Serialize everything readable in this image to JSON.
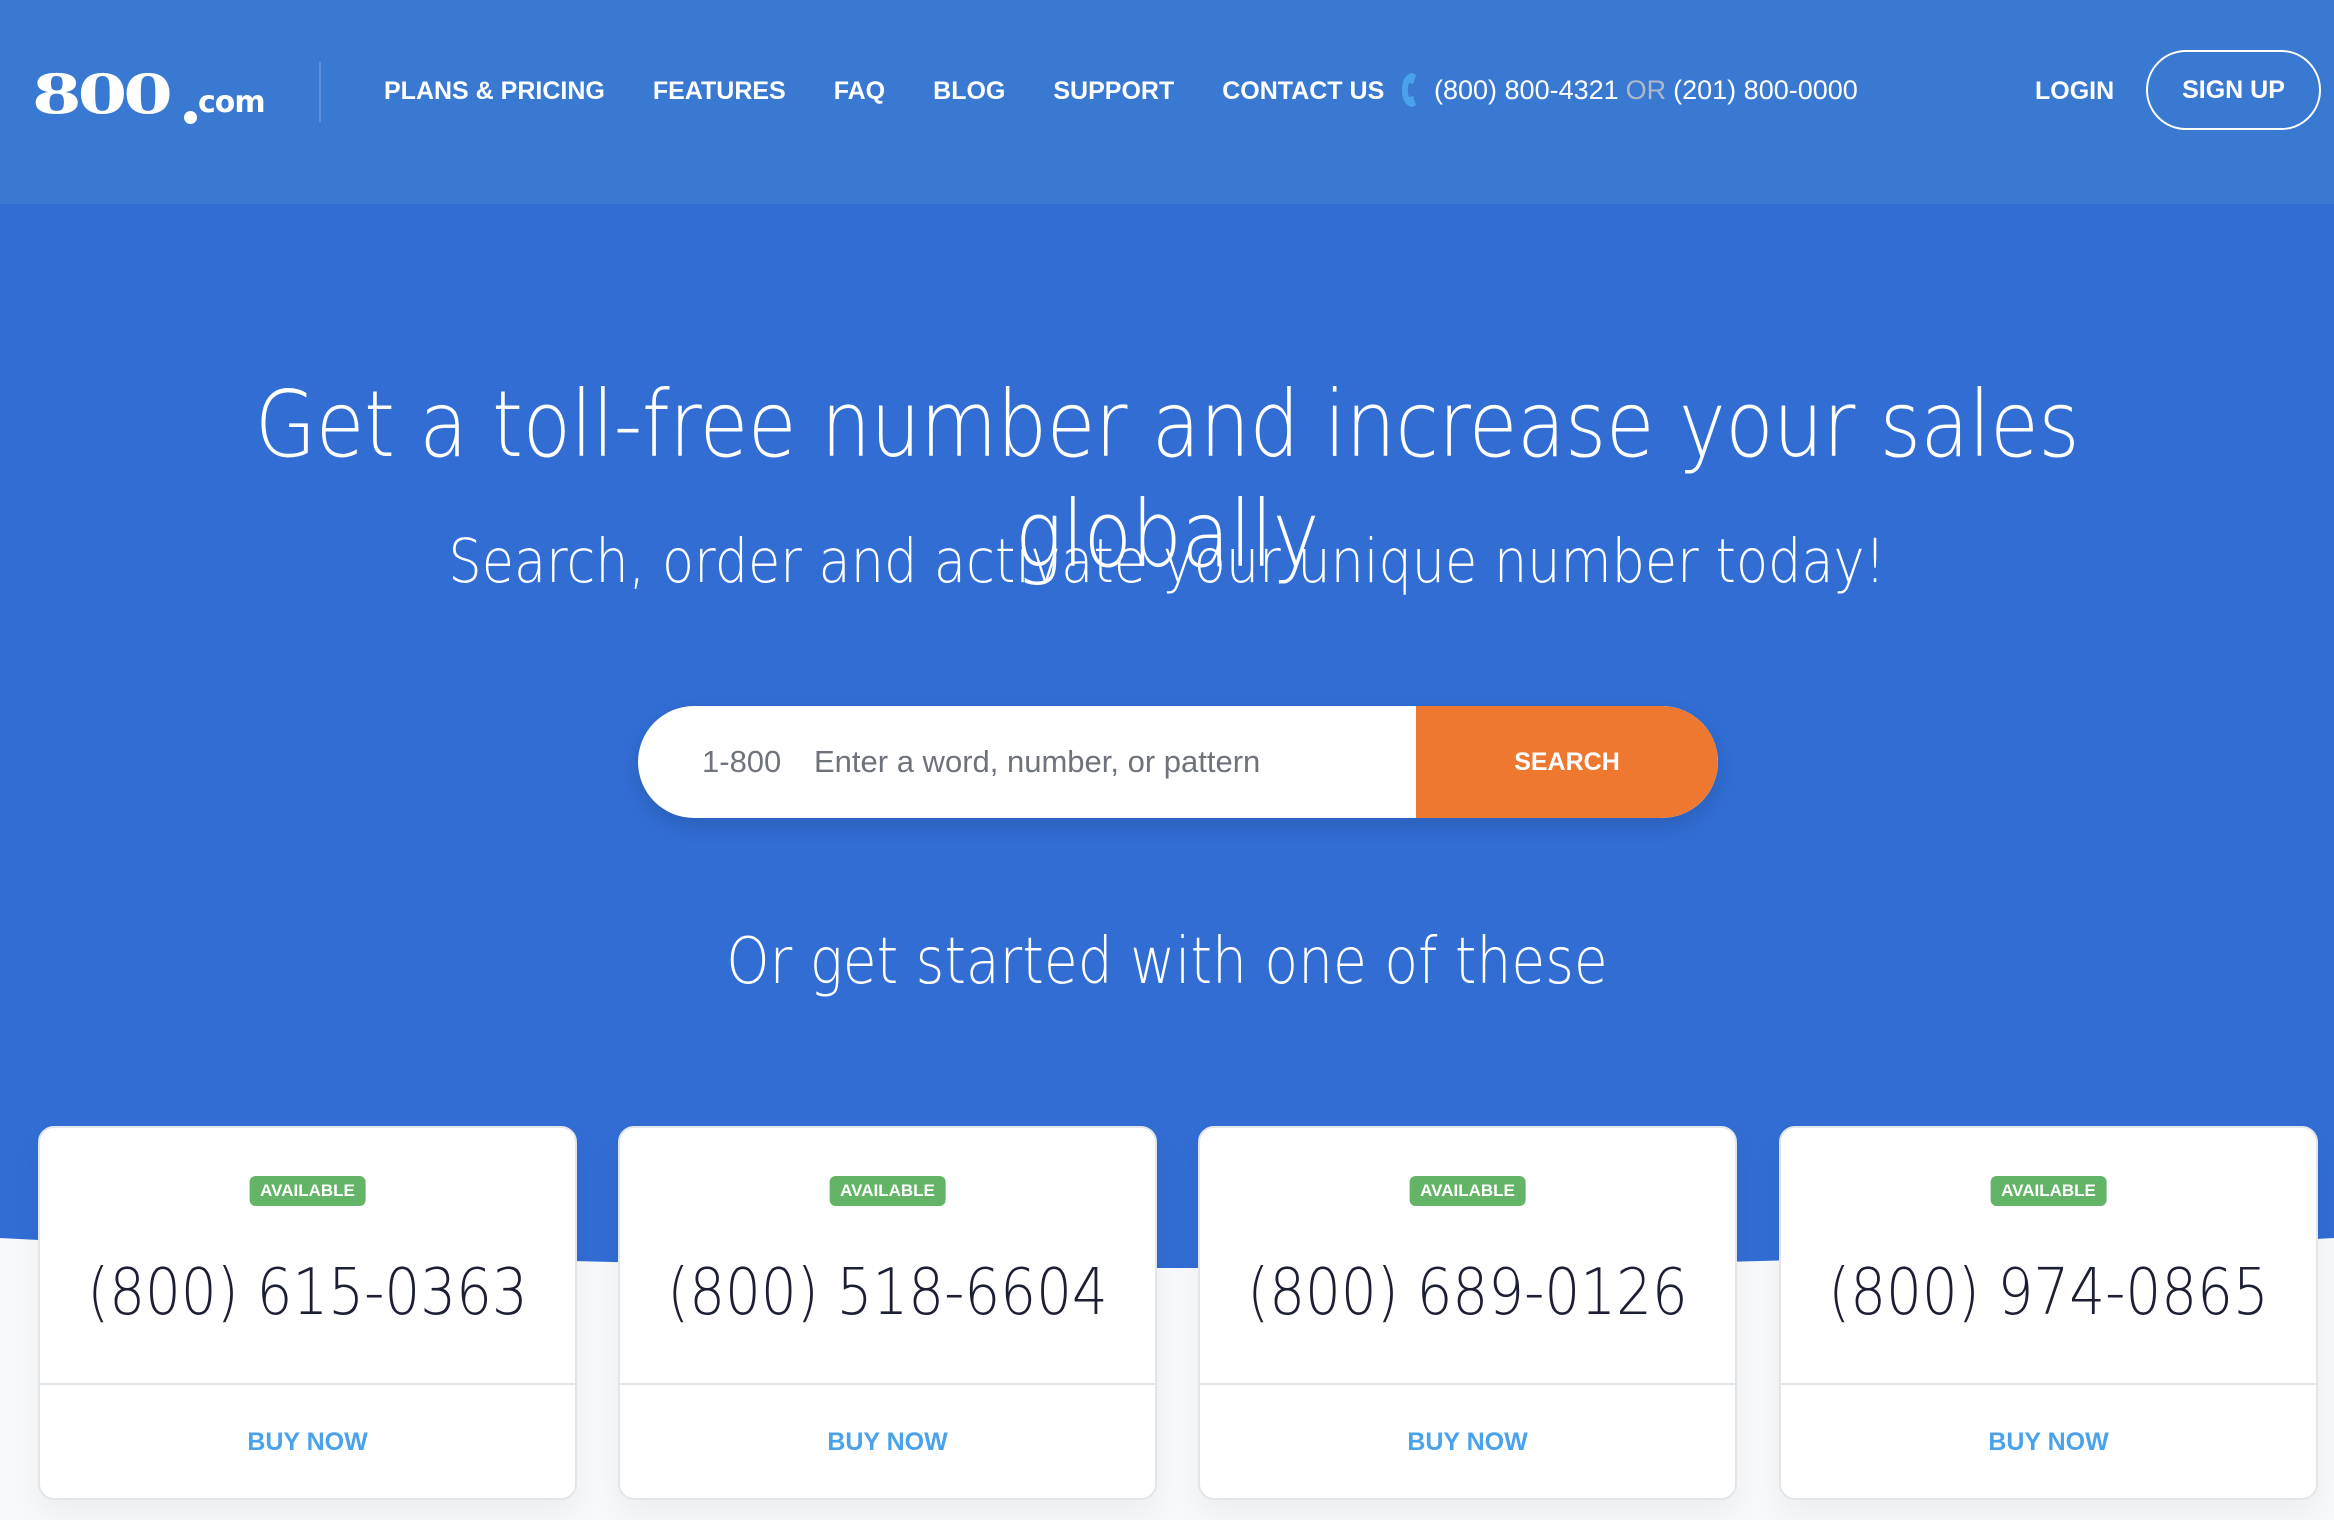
{
  "header": {
    "logo": {
      "number": "800",
      "suffix": "com"
    },
    "nav": [
      {
        "label": "PLANS & PRICING"
      },
      {
        "label": "FEATURES"
      },
      {
        "label": "FAQ"
      },
      {
        "label": "BLOG"
      },
      {
        "label": "SUPPORT"
      },
      {
        "label": "CONTACT US"
      }
    ],
    "contact": {
      "icon": "phone-icon",
      "primary_phone": "(800) 800-4321",
      "separator": "OR",
      "secondary_phone": "(201) 800-0000"
    },
    "login_label": "LOGIN",
    "signup_label": "SIGN UP"
  },
  "hero": {
    "title": "Get a toll-free number and increase your sales globally",
    "subtitle": "Search, order and activate your unique number today!"
  },
  "search": {
    "prefix": "1-800",
    "placeholder": "Enter a word, number, or pattern",
    "value": "",
    "button_label": "SEARCH"
  },
  "suggestions": {
    "heading": "Or get started with one of these",
    "cards": [
      {
        "status": "AVAILABLE",
        "number": "(800) 615-0363",
        "action": "BUY NOW"
      },
      {
        "status": "AVAILABLE",
        "number": "(800) 518-6604",
        "action": "BUY NOW"
      },
      {
        "status": "AVAILABLE",
        "number": "(800) 689-0126",
        "action": "BUY NOW"
      },
      {
        "status": "AVAILABLE",
        "number": "(800) 974-0865",
        "action": "BUY NOW"
      }
    ]
  },
  "colors": {
    "header_bg": "#3979d1",
    "hero_bg": "#316dd3",
    "search_button": "#ef7831",
    "badge_available": "#63b467",
    "buy_link": "#4aa3ea",
    "phone_number_text": "#1c1f33"
  }
}
